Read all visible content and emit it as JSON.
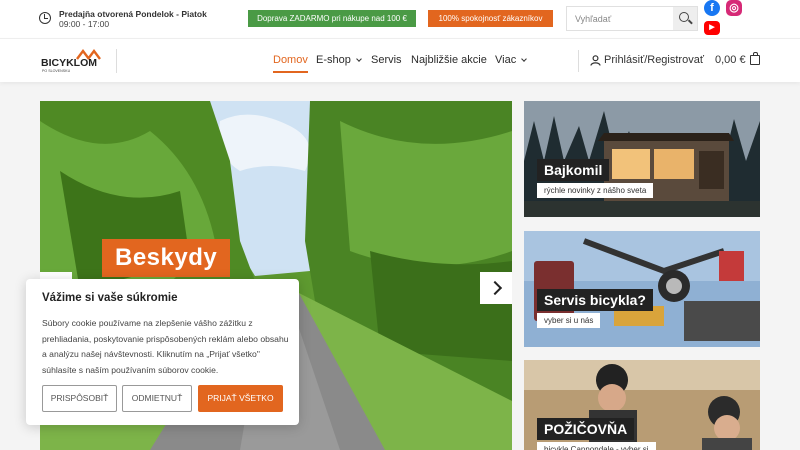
{
  "topbar": {
    "hours_line1": "Predajňa otvorená Pondelok - Piatok",
    "hours_line2": "09:00 - 17:00",
    "promo_shipping": "Doprava ZADARMO pri nákupe nad 100 €",
    "promo_satisfaction": "100% spokojnosť zákazníkov",
    "search_placeholder": "Vyhľadať",
    "social": [
      "facebook-icon",
      "instagram-icon",
      "youtube-icon"
    ]
  },
  "nav": {
    "logo_text": "BICYKLOM",
    "logo_sub": "PO SLOVENSKU",
    "items": [
      {
        "label": "Domov",
        "active": true
      },
      {
        "label": "E-shop",
        "dropdown": true
      },
      {
        "label": "Servis"
      },
      {
        "label": "Najbližšie akcie"
      },
      {
        "label": "Viac",
        "dropdown": true
      }
    ],
    "login": "Prihlásiť/Registrovať",
    "cart_total": "0,00 €"
  },
  "hero": {
    "title": "Beskydy"
  },
  "tiles": [
    {
      "title": "Bajkomil",
      "subtitle": "rýchle novinky z nášho sveta"
    },
    {
      "title": "Servis bicykla?",
      "subtitle": "vyber si u nás"
    },
    {
      "title": "POŽIČOVŇA",
      "subtitle": "bicykle Cannondale - vyber si"
    }
  ],
  "cookie": {
    "title": "Vážime si vaše súkromie",
    "text": "Súbory cookie používame na zlepšenie vášho zážitku z prehliadania, poskytovanie prispôsobených reklám alebo obsahu a analýzu našej návštevnosti. Kliknutím na „Prijať všetko\" súhlasíte s naším používaním súborov cookie.",
    "btn_customize": "PRISPÔSOBIŤ",
    "btn_reject": "ODMIETNUŤ",
    "btn_accept": "PRIJAŤ VŠETKO"
  },
  "colors": {
    "accent": "#e2661f",
    "green": "#4a9a45"
  }
}
